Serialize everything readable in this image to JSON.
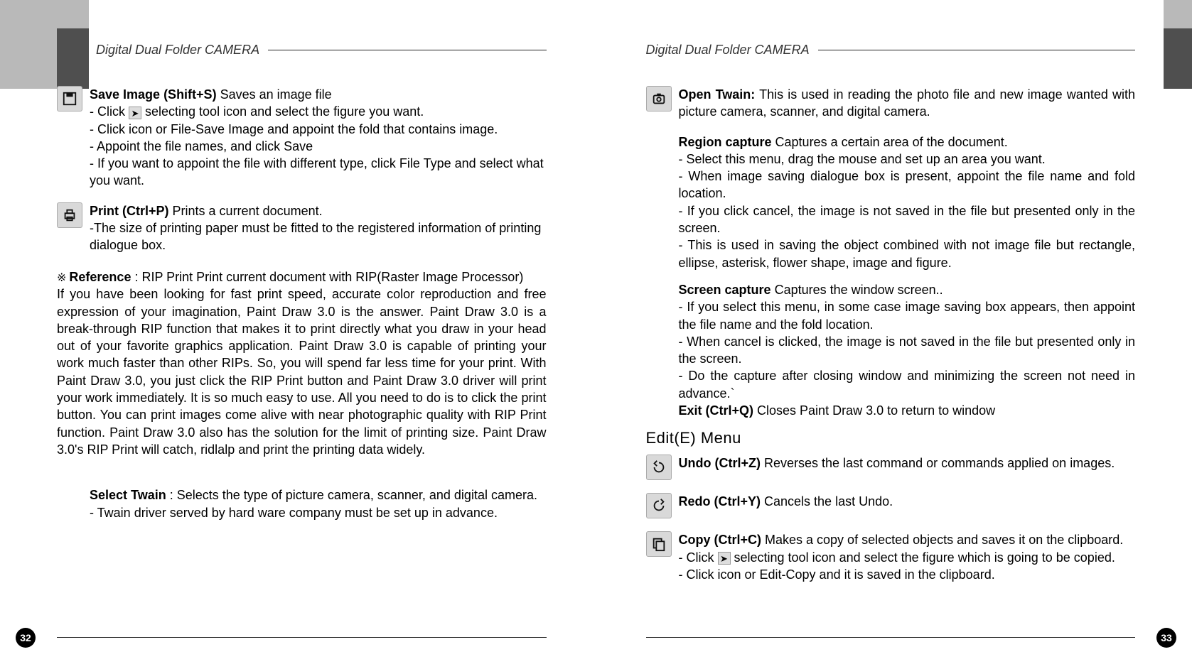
{
  "header": "Digital Dual Folder CAMERA",
  "left": {
    "saveImage": {
      "title": "Save Image (Shift+S)",
      "desc": "Saves an image file",
      "line1a": "- Click ",
      "line1b": " selecting tool icon and select the figure you want.",
      "line2": "- Click icon or File-Save Image and appoint the fold that contains image.",
      "line3": "- Appoint the file names, and click Save",
      "line4": "- If you want to appoint the file with different type, click File Type and select what you want."
    },
    "print": {
      "title": "Print (Ctrl+P)",
      "desc": "Prints a current document.",
      "line1": "-The size of printing paper must be fitted to the registered information of printing dialogue box."
    },
    "reference": {
      "lead": "Reference",
      "tail": " : RIP Print Print current document with RIP(Raster Image Processor)",
      "body": "If you have been looking for fast print speed, accurate color reproduction and free expression of your imagination, Paint Draw 3.0 is the answer.  Paint Draw 3.0 is a break-through RIP function that makes it to print directly what you draw in your head out of your favorite graphics application. Paint Draw 3.0 is capable of printing your work much faster than other RIPs. So, you will spend far less time for your print. With Paint Draw 3.0, you just click the RIP Print button and Paint Draw 3.0 driver will print your work immediately. It is so much easy to use. All you need to do is to click the print button.   You can print images come alive with near photographic quality with RIP Print function. Paint Draw 3.0 also has the solution for the limit of printing size. Paint Draw 3.0's RIP Print will catch, ridlalp and print the printing data widely."
    },
    "selectTwain": {
      "title": "Select Twain",
      "tail": " : Selects the type of picture camera, scanner, and digital camera.",
      "line1": "- Twain driver served by hard ware company must be set up in advance."
    },
    "pageNum": "32"
  },
  "right": {
    "openTwain": {
      "title": "Open Twain:",
      "desc": " This is used in reading the photo file and new image wanted with picture camera, scanner, and digital camera."
    },
    "regionCapture": {
      "title": "Region capture",
      "desc": "  Captures a certain area of the document.",
      "l1": "- Select this menu, drag the mouse and set up an area you want.",
      "l2": "- When image saving dialogue box is present, appoint the file name and fold location.",
      "l3": "- If you click cancel, the image is not saved in the file but presented only in the screen.",
      "l4": "- This is used in saving the object combined with not image file but rectangle, ellipse, asterisk,  flower shape, image and figure."
    },
    "screenCapture": {
      "title": "Screen capture",
      "desc": "  Captures the window screen..",
      "l1": "- If you select this menu, in some case image saving box appears, then appoint the file name and the fold location.",
      "l2": "- When cancel is clicked, the image is not saved in the file but presented only in the screen.",
      "l3": "- Do the capture after closing window and minimizing the screen not need in advance.`"
    },
    "exit": {
      "title": "Exit (Ctrl+Q)",
      "desc": "  Closes Paint Draw 3.0  to return to window"
    },
    "editTitle": "Edit(E) Menu",
    "undo": {
      "title": "Undo (Ctrl+Z)",
      "desc": "  Reverses the last command or commands applied on images."
    },
    "redo": {
      "title": "Redo (Ctrl+Y)",
      "desc": "  Cancels the last Undo."
    },
    "copy": {
      "title": "Copy (Ctrl+C)",
      "desc": "  Makes a copy of selected objects and saves it on the clipboard.",
      "l1a": "- Click ",
      "l1b": " selecting tool icon and select the figure  which is going to be copied.",
      "l2": "- Click icon or Edit-Copy and it is saved in the clipboard."
    },
    "pageNum": "33"
  }
}
